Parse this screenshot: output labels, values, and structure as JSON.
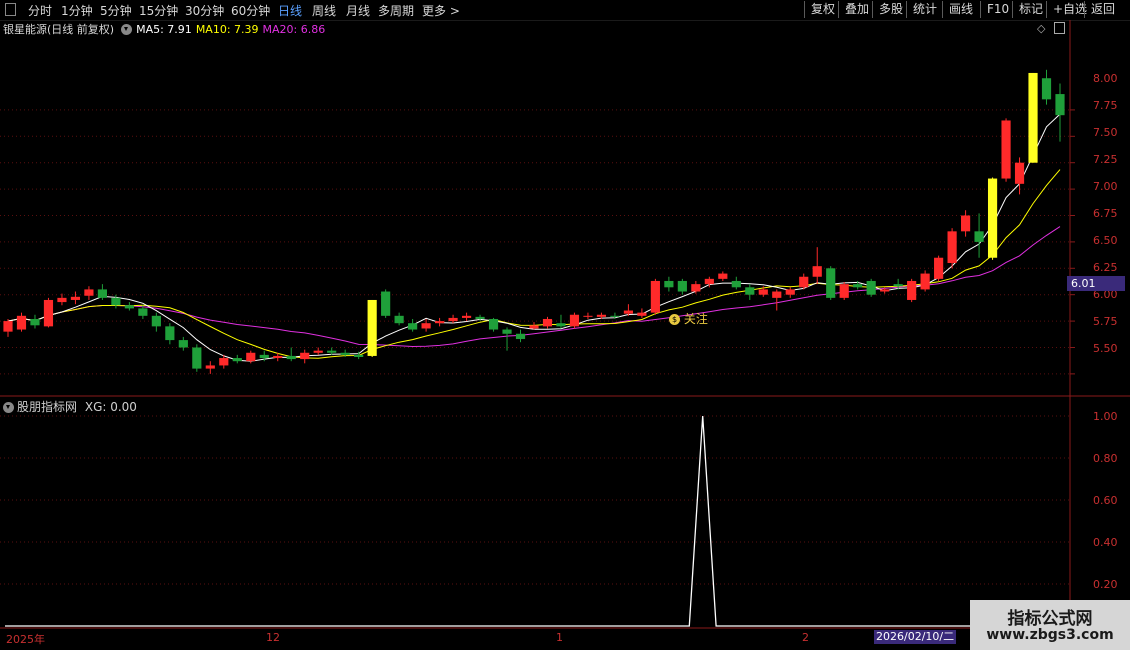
{
  "toolbar": {
    "periods": [
      "分时",
      "1分钟",
      "5分钟",
      "15分钟",
      "30分钟",
      "60分钟",
      "日线",
      "周线",
      "月线",
      "多周期",
      "更多 >"
    ],
    "active_period": "日线",
    "tools": [
      "复权",
      "叠加",
      "多股",
      "统计",
      "画线",
      "F10",
      "标记",
      "+自选",
      "返回"
    ]
  },
  "info": {
    "stock": "银星能源(日线 前复权)",
    "ma5": "MA5: 7.91",
    "ma10": "MA10: 7.39",
    "ma20": "MA20: 6.86"
  },
  "colors": {
    "up": "#ff2a2a",
    "down": "#1fa03a",
    "signal": "#ffff22",
    "ma5": "#ffffff",
    "ma10": "#ffff00",
    "ma20": "#e030e0",
    "axis": "#c83030",
    "grid": "#5a0f0f"
  },
  "price_axis": [
    "8.00",
    "7.75",
    "7.50",
    "7.25",
    "7.00",
    "6.75",
    "6.50",
    "6.25",
    "6.00",
    "5.75",
    "5.50"
  ],
  "current_price_tag": "6.01",
  "marker_label": "关注",
  "indicator": {
    "title": "股朋指标网",
    "xg_label": "XG: 0.00",
    "axis": [
      "1.00",
      "0.80",
      "0.60",
      "0.40",
      "0.20"
    ]
  },
  "dates": {
    "labels": [
      "2025年",
      "12",
      "1",
      "2"
    ],
    "highlight": "2026/02/10/二"
  },
  "watermark": {
    "line1": "指标公式网",
    "line2": "www.zbgs3.com"
  },
  "chart_data": {
    "type": "candlestick",
    "price_range": [
      5.3,
      8.7
    ],
    "indicator_range": [
      0,
      1.0
    ],
    "candles": [
      [
        5.9,
        6.0,
        5.85,
        6.02,
        0
      ],
      [
        5.92,
        6.05,
        5.9,
        6.08,
        0
      ],
      [
        6.02,
        5.96,
        5.93,
        6.06,
        0
      ],
      [
        5.95,
        6.2,
        5.94,
        6.22,
        0
      ],
      [
        6.18,
        6.22,
        6.15,
        6.26,
        0
      ],
      [
        6.2,
        6.23,
        6.16,
        6.28,
        0
      ],
      [
        6.24,
        6.3,
        6.2,
        6.33,
        0
      ],
      [
        6.3,
        6.22,
        6.2,
        6.35,
        0
      ],
      [
        6.22,
        6.15,
        6.12,
        6.25,
        0
      ],
      [
        6.15,
        6.12,
        6.1,
        6.18,
        0
      ],
      [
        6.12,
        6.05,
        6.02,
        6.15,
        0
      ],
      [
        6.05,
        5.95,
        5.9,
        6.08,
        0
      ],
      [
        5.95,
        5.82,
        5.78,
        5.98,
        0
      ],
      [
        5.82,
        5.75,
        5.72,
        5.85,
        0
      ],
      [
        5.75,
        5.55,
        5.52,
        5.78,
        0
      ],
      [
        5.55,
        5.58,
        5.5,
        5.62,
        0
      ],
      [
        5.58,
        5.65,
        5.55,
        5.68,
        0
      ],
      [
        5.65,
        5.62,
        5.6,
        5.68,
        0
      ],
      [
        5.62,
        5.7,
        5.6,
        5.72,
        0
      ],
      [
        5.68,
        5.65,
        5.62,
        5.72,
        0
      ],
      [
        5.65,
        5.67,
        5.62,
        5.7,
        0
      ],
      [
        5.67,
        5.64,
        5.62,
        5.75,
        0
      ],
      [
        5.64,
        5.7,
        5.6,
        5.73,
        0
      ],
      [
        5.7,
        5.72,
        5.68,
        5.75,
        0
      ],
      [
        5.72,
        5.7,
        5.68,
        5.75,
        0
      ],
      [
        5.7,
        5.68,
        5.66,
        5.73,
        0
      ],
      [
        5.68,
        5.66,
        5.64,
        5.71,
        0
      ],
      [
        5.67,
        6.2,
        5.66,
        6.2,
        1
      ],
      [
        6.28,
        6.05,
        6.03,
        6.3,
        0
      ],
      [
        6.05,
        5.98,
        5.96,
        6.08,
        0
      ],
      [
        5.98,
        5.92,
        5.9,
        6.02,
        0
      ],
      [
        5.93,
        5.98,
        5.9,
        6.02,
        0
      ],
      [
        5.98,
        6.0,
        5.95,
        6.03,
        0
      ],
      [
        6.0,
        6.03,
        5.98,
        6.06,
        0
      ],
      [
        6.03,
        6.05,
        6.0,
        6.08,
        0
      ],
      [
        6.04,
        6.02,
        6.0,
        6.06,
        0
      ],
      [
        6.02,
        5.92,
        5.9,
        6.03,
        0
      ],
      [
        5.92,
        5.88,
        5.72,
        5.94,
        0
      ],
      [
        5.88,
        5.83,
        5.8,
        5.92,
        0
      ],
      [
        5.93,
        5.96,
        5.92,
        5.99,
        0
      ],
      [
        5.95,
        6.02,
        5.93,
        6.04,
        0
      ],
      [
        5.98,
        5.95,
        5.93,
        6.06,
        0
      ],
      [
        5.95,
        6.06,
        5.93,
        6.08,
        0
      ],
      [
        6.05,
        6.05,
        6.02,
        6.08,
        0
      ],
      [
        6.04,
        6.06,
        6.02,
        6.08,
        0
      ],
      [
        6.05,
        6.04,
        6.02,
        6.08,
        0
      ],
      [
        6.07,
        6.1,
        6.05,
        6.16,
        0
      ],
      [
        6.05,
        6.08,
        6.03,
        6.12,
        0
      ],
      [
        6.08,
        6.38,
        6.06,
        6.4,
        0
      ],
      [
        6.38,
        6.32,
        6.28,
        6.42,
        0
      ],
      [
        6.38,
        6.28,
        6.25,
        6.4,
        0
      ],
      [
        6.28,
        6.35,
        6.26,
        6.38,
        0
      ],
      [
        6.35,
        6.4,
        6.32,
        6.42,
        0
      ],
      [
        6.4,
        6.45,
        6.38,
        6.47,
        0
      ],
      [
        6.38,
        6.32,
        6.3,
        6.42,
        0
      ],
      [
        6.32,
        6.25,
        6.2,
        6.35,
        0
      ],
      [
        6.25,
        6.3,
        6.23,
        6.33,
        0
      ],
      [
        6.22,
        6.28,
        6.1,
        6.3,
        0
      ],
      [
        6.25,
        6.3,
        6.22,
        6.32,
        0
      ],
      [
        6.32,
        6.42,
        6.3,
        6.45,
        0
      ],
      [
        6.42,
        6.52,
        6.35,
        6.7,
        0
      ],
      [
        6.5,
        6.22,
        6.2,
        6.52,
        0
      ],
      [
        6.22,
        6.35,
        6.2,
        6.37,
        0
      ],
      [
        6.35,
        6.32,
        6.3,
        6.38,
        0
      ],
      [
        6.38,
        6.25,
        6.23,
        6.4,
        0
      ],
      [
        6.28,
        6.3,
        6.26,
        6.32,
        0
      ],
      [
        6.35,
        6.33,
        6.3,
        6.4,
        0
      ],
      [
        6.2,
        6.38,
        6.18,
        6.4,
        0
      ],
      [
        6.3,
        6.45,
        6.28,
        6.48,
        0
      ],
      [
        6.4,
        6.6,
        6.38,
        6.62,
        0
      ],
      [
        6.55,
        6.85,
        6.5,
        6.88,
        0
      ],
      [
        6.85,
        7.0,
        6.8,
        7.05,
        0
      ],
      [
        6.85,
        6.75,
        6.6,
        7.02,
        0
      ],
      [
        6.6,
        7.35,
        6.58,
        7.36,
        1
      ],
      [
        7.35,
        7.9,
        7.32,
        7.92,
        0
      ],
      [
        7.3,
        7.5,
        7.2,
        7.55,
        0
      ],
      [
        7.5,
        8.35,
        7.5,
        8.35,
        1
      ],
      [
        8.3,
        8.1,
        8.05,
        8.38,
        0
      ],
      [
        8.15,
        7.95,
        7.7,
        8.25,
        0
      ]
    ],
    "indicator_xg": [
      0,
      0,
      0,
      0,
      0,
      0,
      0,
      0,
      0,
      0,
      0,
      0,
      0,
      0,
      0,
      0,
      0,
      0,
      0,
      0,
      0,
      0,
      0,
      0,
      0,
      0,
      0,
      0,
      0,
      0,
      0,
      0,
      0,
      0,
      0,
      0,
      0,
      0,
      0,
      0,
      0,
      0,
      0,
      0,
      0,
      0,
      0,
      0,
      0,
      0,
      0,
      0,
      1,
      0,
      0,
      0,
      0,
      0,
      0,
      0,
      0,
      0,
      0,
      0,
      0,
      0,
      0,
      0,
      0,
      0,
      0,
      0,
      0,
      0,
      0,
      0,
      0,
      0,
      0,
      0
    ]
  }
}
